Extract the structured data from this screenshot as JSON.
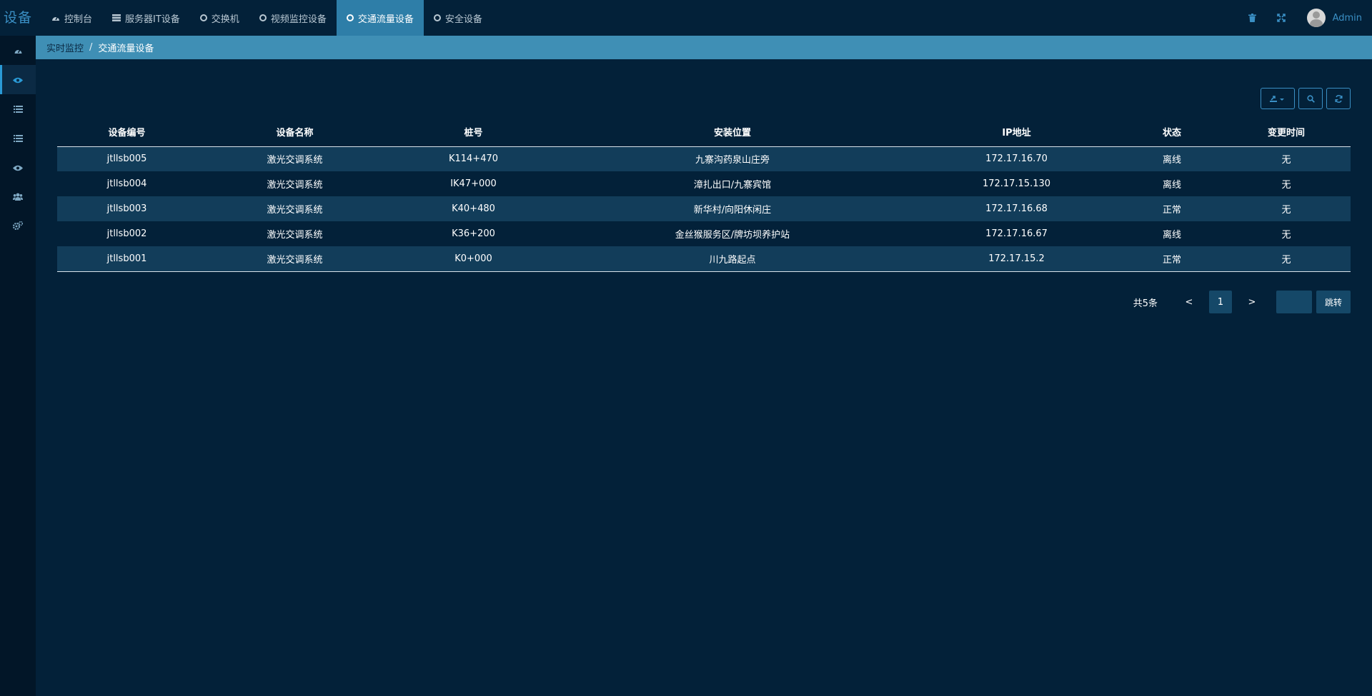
{
  "brand": "设备",
  "nav": {
    "tabs": [
      {
        "label": "控制台",
        "icon": "dashboard-icon",
        "active": false
      },
      {
        "label": "服务器IT设备",
        "icon": "server-icon",
        "active": false
      },
      {
        "label": "交换机",
        "icon": "circle-icon",
        "active": false
      },
      {
        "label": "视频监控设备",
        "icon": "circle-icon",
        "active": false
      },
      {
        "label": "交通流量设备",
        "icon": "circle-icon",
        "active": true
      },
      {
        "label": "安全设备",
        "icon": "circle-icon",
        "active": false
      }
    ],
    "user": "Admin"
  },
  "sidebar": {
    "items": [
      {
        "icon": "dashboard-icon",
        "active": false
      },
      {
        "icon": "eye-icon",
        "active": true
      },
      {
        "icon": "list-icon",
        "active": false
      },
      {
        "icon": "list-icon",
        "active": false
      },
      {
        "icon": "eye-icon",
        "active": false
      },
      {
        "icon": "users-icon",
        "active": false
      },
      {
        "icon": "settings-icon",
        "active": false
      }
    ]
  },
  "breadcrumb": {
    "parent": "实时监控",
    "separator": "/",
    "current": "交通流量设备"
  },
  "table": {
    "columns": [
      "设备编号",
      "设备名称",
      "桩号",
      "安装位置",
      "IP地址",
      "状态",
      "变更时间"
    ],
    "rows": [
      [
        "jtllsb005",
        "激光交调系统",
        "K114+470",
        "九寨沟药泉山庄旁",
        "172.17.16.70",
        "离线",
        "无"
      ],
      [
        "jtllsb004",
        "激光交调系统",
        "IK47+000",
        "漳扎出口/九寨宾馆",
        "172.17.15.130",
        "离线",
        "无"
      ],
      [
        "jtllsb003",
        "激光交调系统",
        "K40+480",
        "新华村/向阳休闲庄",
        "172.17.16.68",
        "正常",
        "无"
      ],
      [
        "jtllsb002",
        "激光交调系统",
        "K36+200",
        "金丝猴服务区/牌坊坝养护站",
        "172.17.16.67",
        "离线",
        "无"
      ],
      [
        "jtllsb001",
        "激光交调系统",
        "K0+000",
        "川九路起点",
        "172.17.15.2",
        "正常",
        "无"
      ]
    ]
  },
  "pagination": {
    "total": "共5条",
    "prev": "<",
    "page": "1",
    "next": ">",
    "jump_value": "",
    "jump_label": "跳转"
  },
  "colors": {
    "background": "#032139",
    "accent": "#2e7ea8",
    "breadcrumb_bg": "#3f8fb5",
    "row_stripe": "#123d5a"
  }
}
